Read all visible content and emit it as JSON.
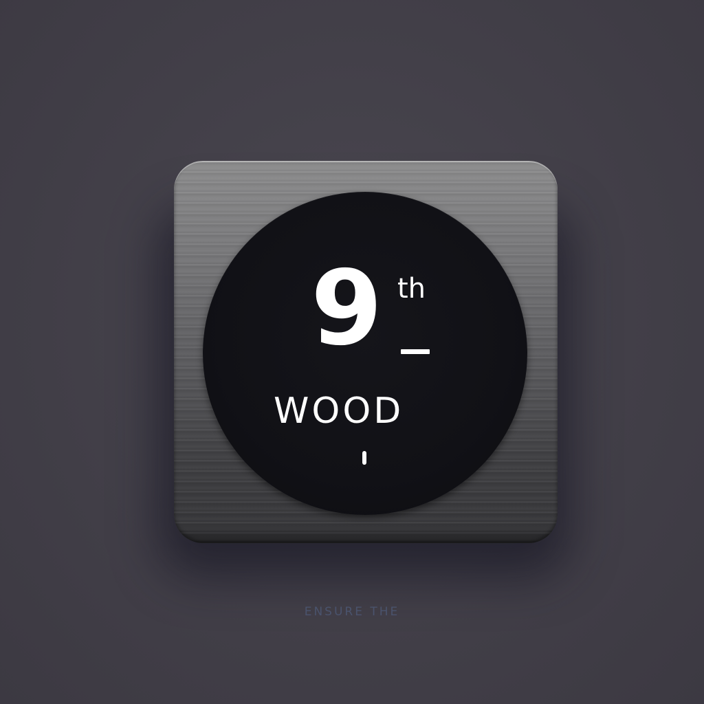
{
  "icon": {
    "numeral": "9",
    "suffix": "th",
    "word": "WOOD"
  },
  "caption": "ENSURE THE",
  "colors": {
    "background": "#434049",
    "tile_top": "#8c8c8d",
    "tile_bottom": "#353538",
    "disc": "#121217",
    "text": "#ffffff",
    "caption": "#4e5b7a"
  }
}
